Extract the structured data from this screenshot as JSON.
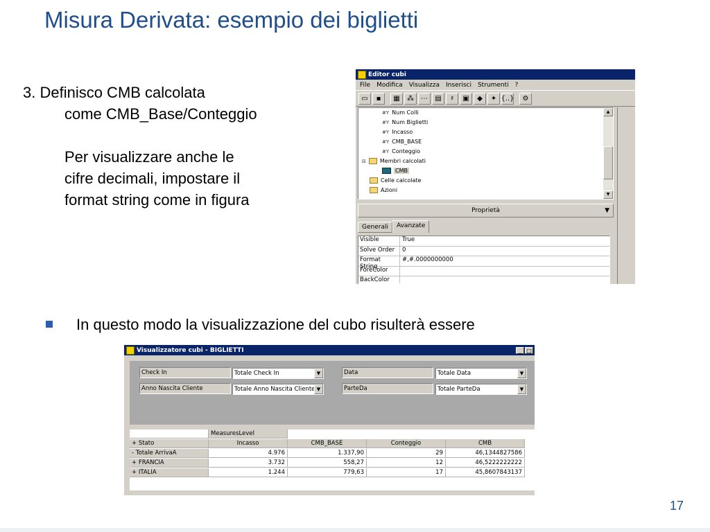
{
  "slide": {
    "title": "Misura Derivata: esempio dei biglietti",
    "step_line1": "3. Definisco CMB calcolata",
    "step_line2": "come CMB_Base/Conteggio",
    "note_line1": "Per visualizzare anche le",
    "note_line2": "cifre decimali, impostare il",
    "note_line3": "format string come in figura",
    "bullet": "In questo modo la visualizzazione del cubo risulterà essere",
    "page_number": "17"
  },
  "editor": {
    "title": "Editor cubi",
    "menu": [
      "File",
      "Modifica",
      "Visualizza",
      "Inserisci",
      "Strumenti",
      "?"
    ],
    "tree": [
      {
        "label": "Num Colli",
        "kind": "measure"
      },
      {
        "label": "Num Biglietti",
        "kind": "measure"
      },
      {
        "label": "Incasso",
        "kind": "measure"
      },
      {
        "label": "CMB_BASE",
        "kind": "measure"
      },
      {
        "label": "Conteggio",
        "kind": "measure"
      },
      {
        "label": "Membri calcolati",
        "kind": "folder-open"
      },
      {
        "label": "CMB",
        "kind": "calc"
      },
      {
        "label": "Celle calcolate",
        "kind": "folder"
      },
      {
        "label": "Azioni",
        "kind": "folder"
      }
    ],
    "properties_label": "Proprietà",
    "tabs": [
      "Generali",
      "Avanzate"
    ],
    "properties": [
      {
        "key": "Visible",
        "value": "True"
      },
      {
        "key": "Solve Order",
        "value": "0"
      },
      {
        "key": "Format String",
        "value": "#,#.0000000000"
      },
      {
        "key": "ForeColor",
        "value": ""
      },
      {
        "key": "BackColor",
        "value": ""
      }
    ]
  },
  "viewer": {
    "title": "Visualizzatore cubi - BIGLIETTI",
    "filters": {
      "check_in_label": "Check In",
      "check_in_value": "Totale Check In",
      "anno_label": "Anno Nascita Cliente",
      "anno_value": "Totale Anno Nascita Cliente",
      "data_label": "Data",
      "data_value": "Totale Data",
      "parteda_label": "ParteDa",
      "parteda_value": "Totale ParteDa"
    },
    "measures_level": "MeasuresLevel",
    "row_header": "+ Stato",
    "columns": [
      "Incasso",
      "CMB_BASE",
      "Conteggio",
      "CMB"
    ],
    "rows": [
      {
        "label": "- Totale ArrivaA",
        "incasso": "4.976",
        "cmb_base": "1.337,90",
        "conteggio": "29",
        "cmb": "46,1344827586"
      },
      {
        "label": "+ FRANCIA",
        "incasso": "3.732",
        "cmb_base": "558,27",
        "conteggio": "12",
        "cmb": "46,5222222222"
      },
      {
        "label": "+ ITALIA",
        "incasso": "1.244",
        "cmb_base": "779,63",
        "conteggio": "17",
        "cmb": "45,8607843137"
      }
    ]
  }
}
